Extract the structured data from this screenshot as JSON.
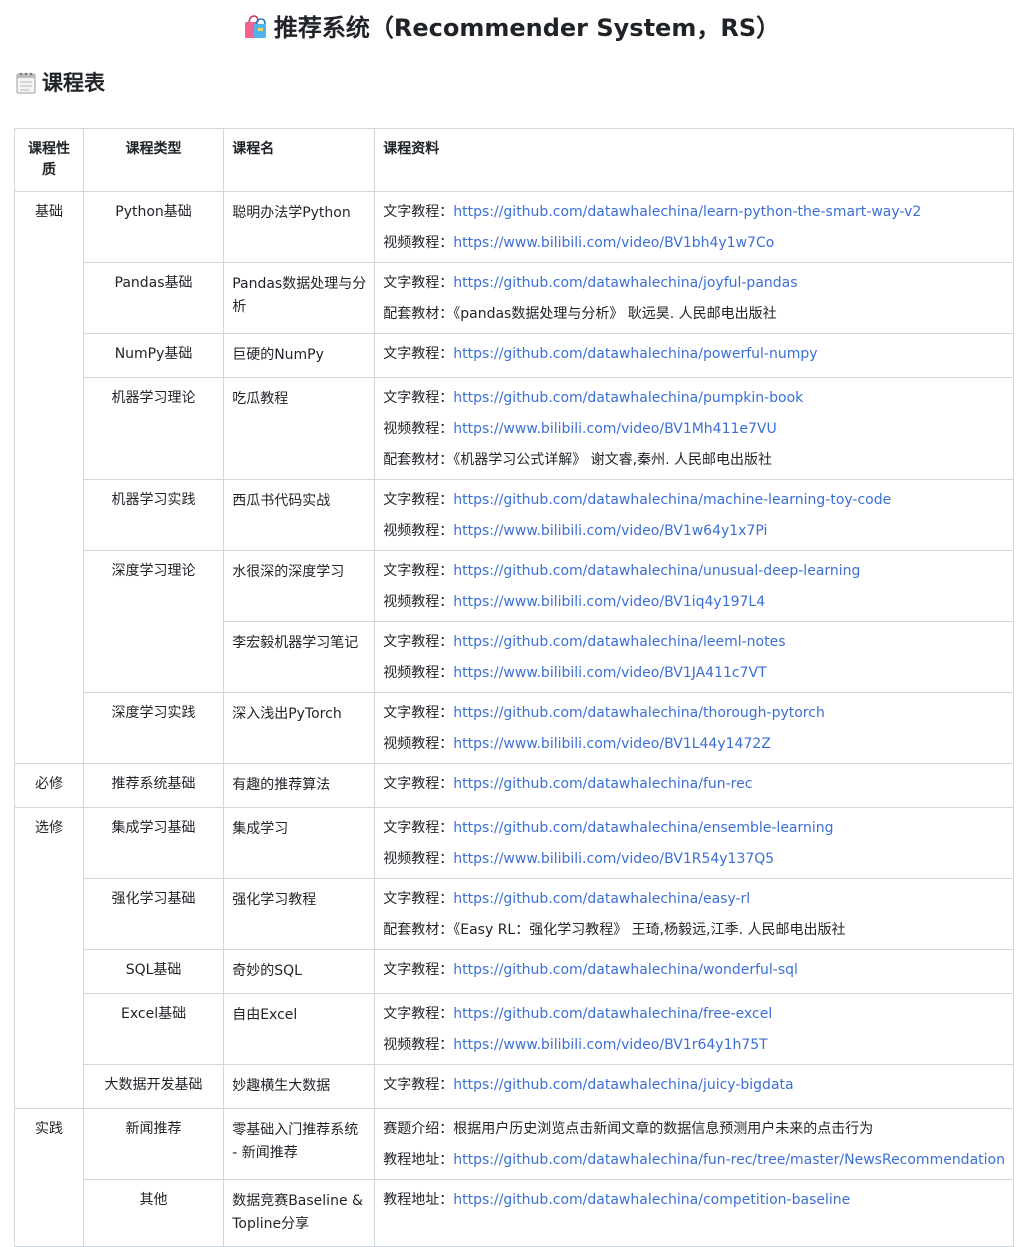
{
  "page": {
    "title": "推荐系统（Recommender System，RS）",
    "title_icon": "shopping-bags-emoji",
    "section_title": "课程表",
    "section_icon": "notepad-emoji"
  },
  "table": {
    "headers": [
      "课程性质",
      "课程类型",
      "课程名",
      "课程资料"
    ],
    "rows": [
      {
        "nature": "基础",
        "type": "Python基础",
        "name": "聪明办法学Python",
        "res": [
          {
            "label": "文字教程：",
            "link": "https://github.com/datawhalechina/learn-python-the-smart-way-v2"
          },
          {
            "label": "视频教程：",
            "link": "https://www.bilibili.com/video/BV1bh4y1w7Co"
          }
        ]
      },
      {
        "nature": "",
        "type": "Pandas基础",
        "name": "Pandas数据处理与分析",
        "res": [
          {
            "label": "文字教程：",
            "link": "https://github.com/datawhalechina/joyful-pandas"
          },
          {
            "label": "配套教材：",
            "text": "《pandas数据处理与分析》 耿远昊. 人民邮电出版社"
          }
        ]
      },
      {
        "nature": "",
        "type": "NumPy基础",
        "name": "巨硬的NumPy",
        "res": [
          {
            "label": "文字教程：",
            "link": "https://github.com/datawhalechina/powerful-numpy"
          }
        ]
      },
      {
        "nature": "",
        "type": "机器学习理论",
        "name": "吃瓜教程",
        "res": [
          {
            "label": "文字教程：",
            "link": "https://github.com/datawhalechina/pumpkin-book"
          },
          {
            "label": "视频教程：",
            "link": "https://www.bilibili.com/video/BV1Mh411e7VU"
          },
          {
            "label": "配套教材：",
            "text": "《机器学习公式详解》 谢文睿,秦州. 人民邮电出版社"
          }
        ]
      },
      {
        "nature": "",
        "type": "机器学习实践",
        "name": "西瓜书代码实战",
        "res": [
          {
            "label": "文字教程：",
            "link": "https://github.com/datawhalechina/machine-learning-toy-code"
          },
          {
            "label": "视频教程：",
            "link": "https://www.bilibili.com/video/BV1w64y1x7Pi"
          }
        ]
      },
      {
        "nature": "",
        "type": "深度学习理论",
        "name": "水很深的深度学习",
        "res": [
          {
            "label": "文字教程：",
            "link": "https://github.com/datawhalechina/unusual-deep-learning"
          },
          {
            "label": "视频教程：",
            "link": "https://www.bilibili.com/video/BV1iq4y197L4"
          }
        ]
      },
      {
        "nature": "",
        "type": "",
        "name": "李宏毅机器学习笔记",
        "res": [
          {
            "label": "文字教程：",
            "link": "https://github.com/datawhalechina/leeml-notes"
          },
          {
            "label": "视频教程：",
            "link": "https://www.bilibili.com/video/BV1JA411c7VT"
          }
        ]
      },
      {
        "nature": "",
        "type": "深度学习实践",
        "name": "深入浅出PyTorch",
        "res": [
          {
            "label": "文字教程：",
            "link": "https://github.com/datawhalechina/thorough-pytorch"
          },
          {
            "label": "视频教程：",
            "link": "https://www.bilibili.com/video/BV1L44y1472Z"
          }
        ]
      },
      {
        "nature": "必修",
        "type": "推荐系统基础",
        "name": "有趣的推荐算法",
        "res": [
          {
            "label": "文字教程：",
            "link": "https://github.com/datawhalechina/fun-rec"
          }
        ]
      },
      {
        "nature": "选修",
        "type": "集成学习基础",
        "name": "集成学习",
        "res": [
          {
            "label": "文字教程：",
            "link": "https://github.com/datawhalechina/ensemble-learning"
          },
          {
            "label": "视频教程：",
            "link": "https://www.bilibili.com/video/BV1R54y137Q5"
          }
        ]
      },
      {
        "nature": "",
        "type": "强化学习基础",
        "name": "强化学习教程",
        "res": [
          {
            "label": "文字教程：",
            "link": "https://github.com/datawhalechina/easy-rl"
          },
          {
            "label": "配套教材：",
            "text": "《Easy RL：强化学习教程》 王琦,杨毅远,江季. 人民邮电出版社"
          }
        ]
      },
      {
        "nature": "",
        "type": "SQL基础",
        "name": "奇妙的SQL",
        "res": [
          {
            "label": "文字教程：",
            "link": "https://github.com/datawhalechina/wonderful-sql"
          }
        ]
      },
      {
        "nature": "",
        "type": "Excel基础",
        "name": "自由Excel",
        "res": [
          {
            "label": "文字教程：",
            "link": "https://github.com/datawhalechina/free-excel"
          },
          {
            "label": "视频教程：",
            "link": "https://www.bilibili.com/video/BV1r64y1h75T"
          }
        ]
      },
      {
        "nature": "",
        "type": "大数据开发基础",
        "name": "妙趣横生大数据",
        "res": [
          {
            "label": "文字教程：",
            "link": "https://github.com/datawhalechina/juicy-bigdata"
          }
        ]
      },
      {
        "nature": "实践",
        "type": "新闻推荐",
        "name": "零基础入门推荐系统 - 新闻推荐",
        "res": [
          {
            "label": "赛题介绍：",
            "text": "根据用户历史浏览点击新闻文章的数据信息预测用户未来的点击行为"
          },
          {
            "label": "教程地址：",
            "link": "https://github.com/datawhalechina/fun-rec/tree/master/NewsRecommendation"
          }
        ]
      },
      {
        "nature": "",
        "type": "其他",
        "name": "数据竞赛Baseline & Topline分享",
        "res": [
          {
            "label": "教程地址：",
            "link": "https://github.com/datawhalechina/competition-baseline"
          }
        ]
      }
    ]
  }
}
